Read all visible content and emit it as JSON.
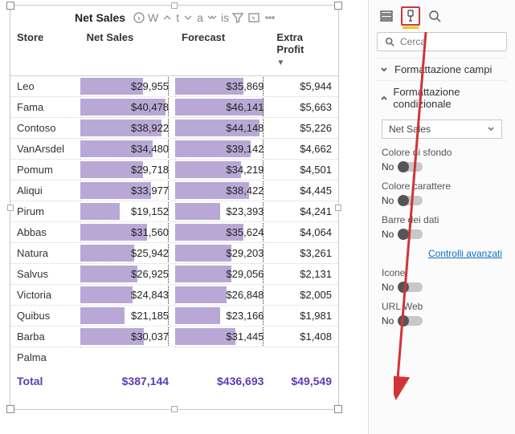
{
  "visual": {
    "title": "Net Sales",
    "header_fragments": [
      "W",
      "t",
      "a",
      "is"
    ]
  },
  "columns": {
    "store": "Store",
    "net_sales": "Net Sales",
    "forecast": "Forecast",
    "extra_profit": "Extra Profit"
  },
  "rows": [
    {
      "store": "Leo",
      "net_sales": "$29,955",
      "forecast": "$35,869",
      "extra_profit": "$5,944",
      "ns_pct": 66,
      "fc_pct": 72
    },
    {
      "store": "Fama",
      "net_sales": "$40,478",
      "forecast": "$46,141",
      "extra_profit": "$5,663",
      "ns_pct": 90,
      "fc_pct": 93
    },
    {
      "store": "Contoso",
      "net_sales": "$38,922",
      "forecast": "$44,148",
      "extra_profit": "$5,226",
      "ns_pct": 86,
      "fc_pct": 89
    },
    {
      "store": "VanArsdel",
      "net_sales": "$34,480",
      "forecast": "$39,142",
      "extra_profit": "$4,662",
      "ns_pct": 76,
      "fc_pct": 79
    },
    {
      "store": "Pomum",
      "net_sales": "$29,718",
      "forecast": "$34,219",
      "extra_profit": "$4,501",
      "ns_pct": 66,
      "fc_pct": 69
    },
    {
      "store": "Aliqui",
      "net_sales": "$33,977",
      "forecast": "$38,422",
      "extra_profit": "$4,445",
      "ns_pct": 75,
      "fc_pct": 78
    },
    {
      "store": "Pirum",
      "net_sales": "$19,152",
      "forecast": "$23,393",
      "extra_profit": "$4,241",
      "ns_pct": 42,
      "fc_pct": 47
    },
    {
      "store": "Abbas",
      "net_sales": "$31,560",
      "forecast": "$35,624",
      "extra_profit": "$4,064",
      "ns_pct": 70,
      "fc_pct": 72
    },
    {
      "store": "Natura",
      "net_sales": "$25,942",
      "forecast": "$29,203",
      "extra_profit": "$3,261",
      "ns_pct": 57,
      "fc_pct": 59
    },
    {
      "store": "Salvus",
      "net_sales": "$26,925",
      "forecast": "$29,056",
      "extra_profit": "$2,131",
      "ns_pct": 60,
      "fc_pct": 59
    },
    {
      "store": "Victoria",
      "net_sales": "$24,843",
      "forecast": "$26,848",
      "extra_profit": "$2,005",
      "ns_pct": 55,
      "fc_pct": 54
    },
    {
      "store": "Quibus",
      "net_sales": "$21,185",
      "forecast": "$23,166",
      "extra_profit": "$1,981",
      "ns_pct": 47,
      "fc_pct": 47
    },
    {
      "store": "Barba",
      "net_sales": "$30,037",
      "forecast": "$31,445",
      "extra_profit": "$1,408",
      "ns_pct": 67,
      "fc_pct": 63
    },
    {
      "store": "Palma",
      "net_sales": "",
      "forecast": "",
      "extra_profit": "",
      "ns_pct": 0,
      "fc_pct": 0
    }
  ],
  "totals": {
    "label": "Total",
    "net_sales": "$387,144",
    "forecast": "$436,693",
    "extra_profit": "$49,549"
  },
  "pane": {
    "search_placeholder": "Cerca",
    "section_fields": "Formattazione campi",
    "section_conditional": "Formattazione condizionale",
    "dropdown_value": "Net Sales",
    "toggles": {
      "bg": {
        "label": "Colore di sfondo",
        "value": "No"
      },
      "font": {
        "label": "Colore carattere",
        "value": "No"
      },
      "bars": {
        "label": "Barre dei dati",
        "value": "No"
      },
      "icons": {
        "label": "Icone",
        "value": "No"
      },
      "url": {
        "label": "URL Web",
        "value": "No"
      }
    },
    "advanced_link": "Controlli avanzati"
  },
  "chart_data": {
    "type": "table",
    "title": "Net Sales",
    "columns": [
      "Store",
      "Net Sales",
      "Forecast",
      "Extra Profit"
    ],
    "series": [
      {
        "name": "Net Sales",
        "values": [
          29955,
          40478,
          38922,
          34480,
          29718,
          33977,
          19152,
          31560,
          25942,
          26925,
          24843,
          21185,
          30037,
          null
        ]
      },
      {
        "name": "Forecast",
        "values": [
          35869,
          46141,
          44148,
          39142,
          34219,
          38422,
          23393,
          35624,
          29203,
          29056,
          26848,
          23166,
          31445,
          null
        ]
      },
      {
        "name": "Extra Profit",
        "values": [
          5944,
          5663,
          5226,
          4662,
          4501,
          4445,
          4241,
          4064,
          3261,
          2131,
          2005,
          1981,
          1408,
          null
        ]
      }
    ],
    "categories": [
      "Leo",
      "Fama",
      "Contoso",
      "VanArsdel",
      "Pomum",
      "Aliqui",
      "Pirum",
      "Abbas",
      "Natura",
      "Salvus",
      "Victoria",
      "Quibus",
      "Barba",
      "Palma"
    ],
    "totals": {
      "Net Sales": 387144,
      "Forecast": 436693,
      "Extra Profit": 49549
    },
    "data_bars_on": [
      "Net Sales",
      "Forecast"
    ],
    "sort": {
      "column": "Extra Profit",
      "direction": "desc"
    }
  }
}
